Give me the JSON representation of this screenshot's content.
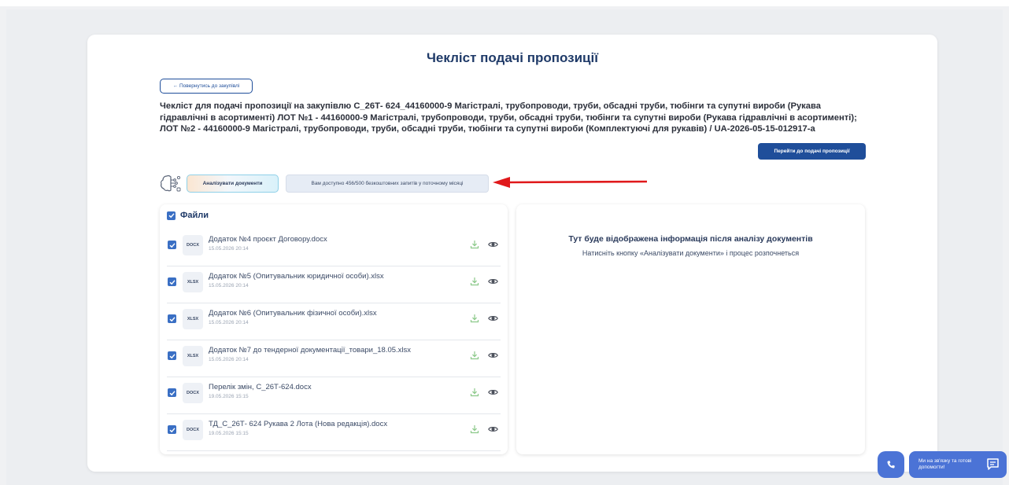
{
  "header": {
    "title": "Чекліст подачі пропозиції",
    "back_label": "← Повернутись до закупівлі"
  },
  "procurement": {
    "description": "Чекліст для подачі пропозиції на закупівлю С_26Т- 624_44160000-9 Магістралі, трубопроводи, труби, обсадні труби, тюбінги та супутні вироби (Рукава гідравлічні в асортименті) ЛОТ №1 - 44160000-9 Магістралі, трубопроводи, труби, обсадні труби, тюбінги та супутні вироби (Рукава гідравлічні в асортименті); ЛОТ №2 - 44160000-9 Магістралі, трубопроводи, труби, обсадні труби, тюбінги та супутні вироби (Комплектуючі для рукавів) / UA-2026-05-15-012917-a",
    "submit_label": "Перейти до подачі пропозиції"
  },
  "analysis": {
    "analyze_label": "Аналізувати документи",
    "quota_text": "Вам доступно 456/500 безкоштовних запитів у поточному місяці"
  },
  "files": {
    "title": "Файли",
    "items": [
      {
        "type": "DOCX",
        "name": "Додаток №4 проєкт Договору.docx",
        "date": "15.05.2026 20:14"
      },
      {
        "type": "XLSX",
        "name": "Додаток №5 (Опитувальник юридичної особи).xlsx",
        "date": "15.05.2026 20:14"
      },
      {
        "type": "XLSX",
        "name": "Додаток №6 (Опитувальник фізичної особи).xlsx",
        "date": "15.05.2026 20:14"
      },
      {
        "type": "XLSX",
        "name": "Додаток №7 до тендерної документації_товари_18.05.xlsx",
        "date": "15.05.2026 20:14"
      },
      {
        "type": "DOCX",
        "name": "Перелік змін, С_26Т-624.docx",
        "date": "19.05.2026 15:15"
      },
      {
        "type": "DOCX",
        "name": "ТД_С_26Т- 624 Рукава 2 Лота (Нова редакція).docx",
        "date": "19.05.2026 15:15"
      }
    ]
  },
  "info": {
    "title": "Тут буде відображена інформація після аналізу документів",
    "text": "Натисніть кнопку «Аналізувати документи» і процес розпочнеться"
  },
  "help": {
    "text": "Ми на зв'язку та готові допомогти!"
  },
  "icons": {
    "checkbox": "check-icon",
    "download": "download-icon",
    "preview": "eye-icon",
    "ai": "ai-brain-icon",
    "call": "phone-icon",
    "chat": "chat-icon"
  },
  "colors": {
    "primary": "#1f4e9a",
    "title": "#1f3a68",
    "checkbox": "#3a6fc4",
    "download_icon": "#8cc98a",
    "annotation_arrow": "#e0191b",
    "help_widget": "#4b73d6"
  }
}
